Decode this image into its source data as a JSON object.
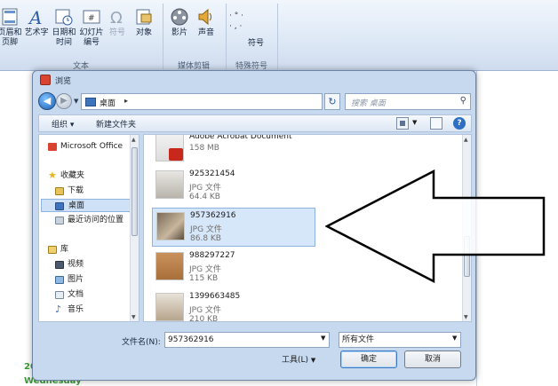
{
  "ribbon": {
    "buttons": [
      {
        "label": "页眉和\n页脚",
        "icon": "header-footer-icon"
      },
      {
        "label": "艺术字",
        "icon": "wordart-icon"
      },
      {
        "label": "日期和\n时间",
        "icon": "date-time-icon"
      },
      {
        "label": "幻灯片\n编号",
        "icon": "slide-number-icon"
      },
      {
        "label": "符号",
        "icon": "omega-icon"
      },
      {
        "label": "对象",
        "icon": "object-icon"
      },
      {
        "label": "影片",
        "icon": "film-reel-icon"
      },
      {
        "label": "声音",
        "icon": "speaker-icon"
      },
      {
        "label": "符号",
        "icon": "special-symbol-icon"
      }
    ],
    "groups": {
      "text": "文本",
      "media": "媒体剪辑",
      "special": "特殊符号"
    },
    "symbol_dots": "· ° ·\n· , ·"
  },
  "slide": {
    "year": "20",
    "day": "Wednesday"
  },
  "dialog": {
    "title": "浏览",
    "address": {
      "location": "桌面",
      "chevron": "▸"
    },
    "search": {
      "placeholder": "搜索 桌面"
    },
    "toolbar": {
      "organize": "组织 ▾",
      "new_folder": "新建文件夹"
    },
    "nav": [
      {
        "label": "Microsoft Office",
        "icon": "office-icon"
      },
      {
        "label": "收藏夹",
        "icon": "star-icon"
      },
      {
        "label": "下载",
        "icon": "download-folder-icon"
      },
      {
        "label": "桌面",
        "icon": "desktop-icon"
      },
      {
        "label": "最近访问的位置",
        "icon": "recent-places-icon"
      },
      {
        "label": "库",
        "icon": "library-icon"
      },
      {
        "label": "视频",
        "icon": "video-library-icon"
      },
      {
        "label": "图片",
        "icon": "pictures-library-icon"
      },
      {
        "label": "文档",
        "icon": "documents-library-icon"
      },
      {
        "label": "音乐",
        "icon": "music-library-icon"
      }
    ],
    "files": [
      {
        "name": "Adobe Acrobat Document",
        "type": "",
        "size": "158 MB"
      },
      {
        "name": "925321454",
        "type": "JPG 文件",
        "size": "64.4 KB"
      },
      {
        "name": "957362916",
        "type": "JPG 文件",
        "size": "86.8 KB"
      },
      {
        "name": "988297227",
        "type": "JPG 文件",
        "size": "115 KB"
      },
      {
        "name": "1399663485",
        "type": "JPG 文件",
        "size": "210 KB"
      }
    ],
    "filename_label": "文件名(N):",
    "filename_value": "957362916",
    "filetype_value": "所有文件",
    "tools_label": "工具(L)",
    "ok_label": "确定",
    "cancel_label": "取消"
  },
  "colors": {
    "accent": "#3b79c3",
    "selection": "#d7e7fa",
    "ribbon": "#dde8f6"
  }
}
